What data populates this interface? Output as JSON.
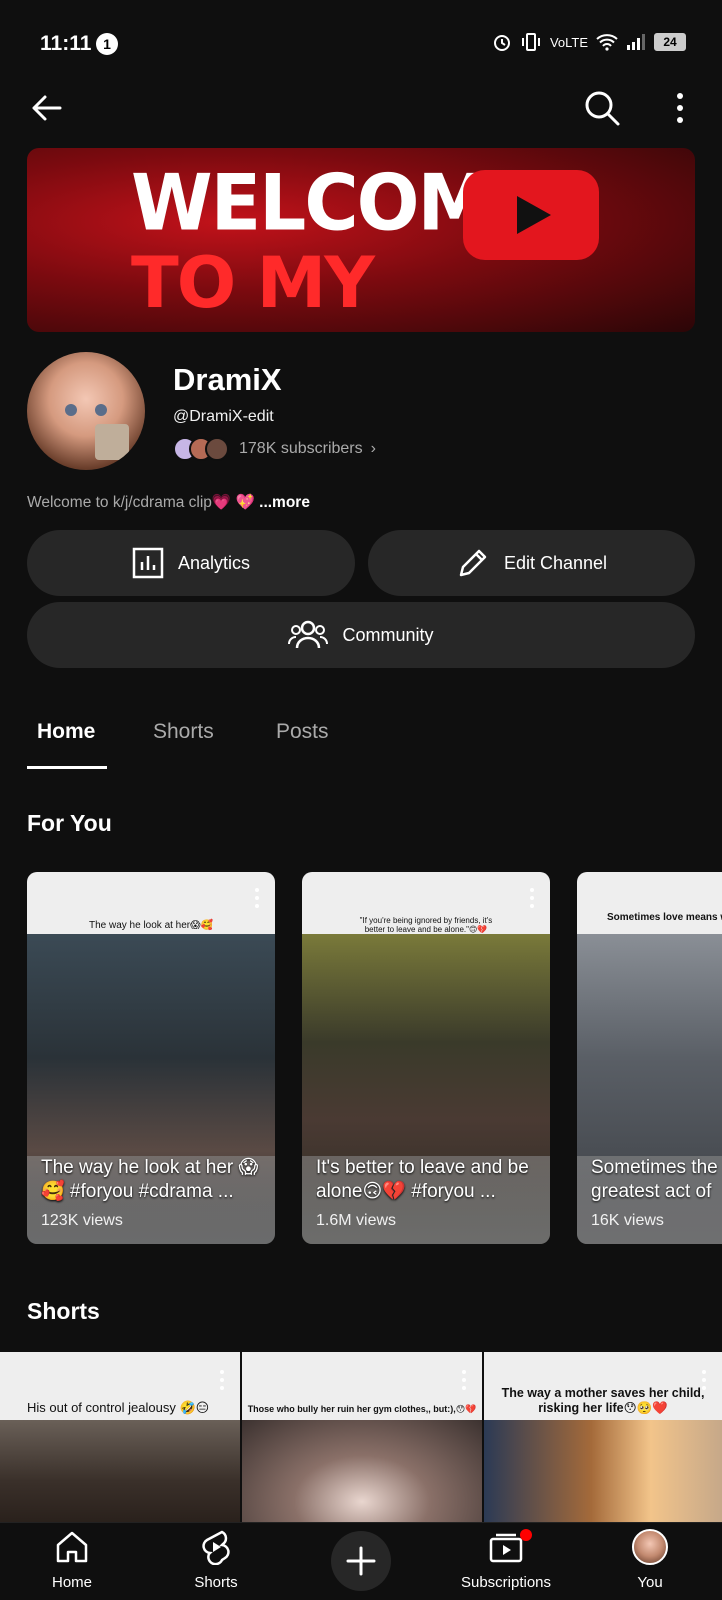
{
  "status_bar": {
    "time": "11:11",
    "notification_count": "1",
    "network_label": "VoLTE",
    "battery": "24"
  },
  "banner": {
    "line1": "WELCOME",
    "line2": "TO MY CHANNEL"
  },
  "channel": {
    "name": "DramiX",
    "handle": "@DramiX-edit",
    "subscribers": "178K subscribers",
    "description": "Welcome to k/j/cdrama clip💗 💖",
    "more_label": "...more"
  },
  "actions": {
    "analytics": "Analytics",
    "edit_channel": "Edit Channel",
    "community": "Community"
  },
  "tabs": [
    {
      "label": "Home",
      "active": true
    },
    {
      "label": "Shorts",
      "active": false
    },
    {
      "label": "Posts",
      "active": false
    }
  ],
  "sections": {
    "for_you": "For You",
    "shorts": "Shorts"
  },
  "for_you_cards": [
    {
      "caption": "The way he look at her😱🥰",
      "title": "The way he look at her 😱🥰 #foryou #cdrama ...",
      "views": "123K views"
    },
    {
      "caption": "\"If you're being ignored by friends, it's better to leave and be alone.\"🙃💔",
      "title": "It's better to leave and be alone🙃💔 #foryou ...",
      "views": "1.6M views"
    },
    {
      "caption": "Sometimes love means watc even when it's not w",
      "title": "Sometimes the greatest act of",
      "views": "16K views"
    }
  ],
  "shorts": [
    {
      "caption": "His out of control jealousy 🤣😑"
    },
    {
      "caption": "Those who bully her ruin her gym clothes,, but:),😯💔"
    },
    {
      "caption": "The way a mother saves her child, risking her life😯🥺❤️"
    }
  ],
  "bottom_nav": {
    "home": "Home",
    "shorts": "Shorts",
    "subscriptions": "Subscriptions",
    "you": "You"
  }
}
